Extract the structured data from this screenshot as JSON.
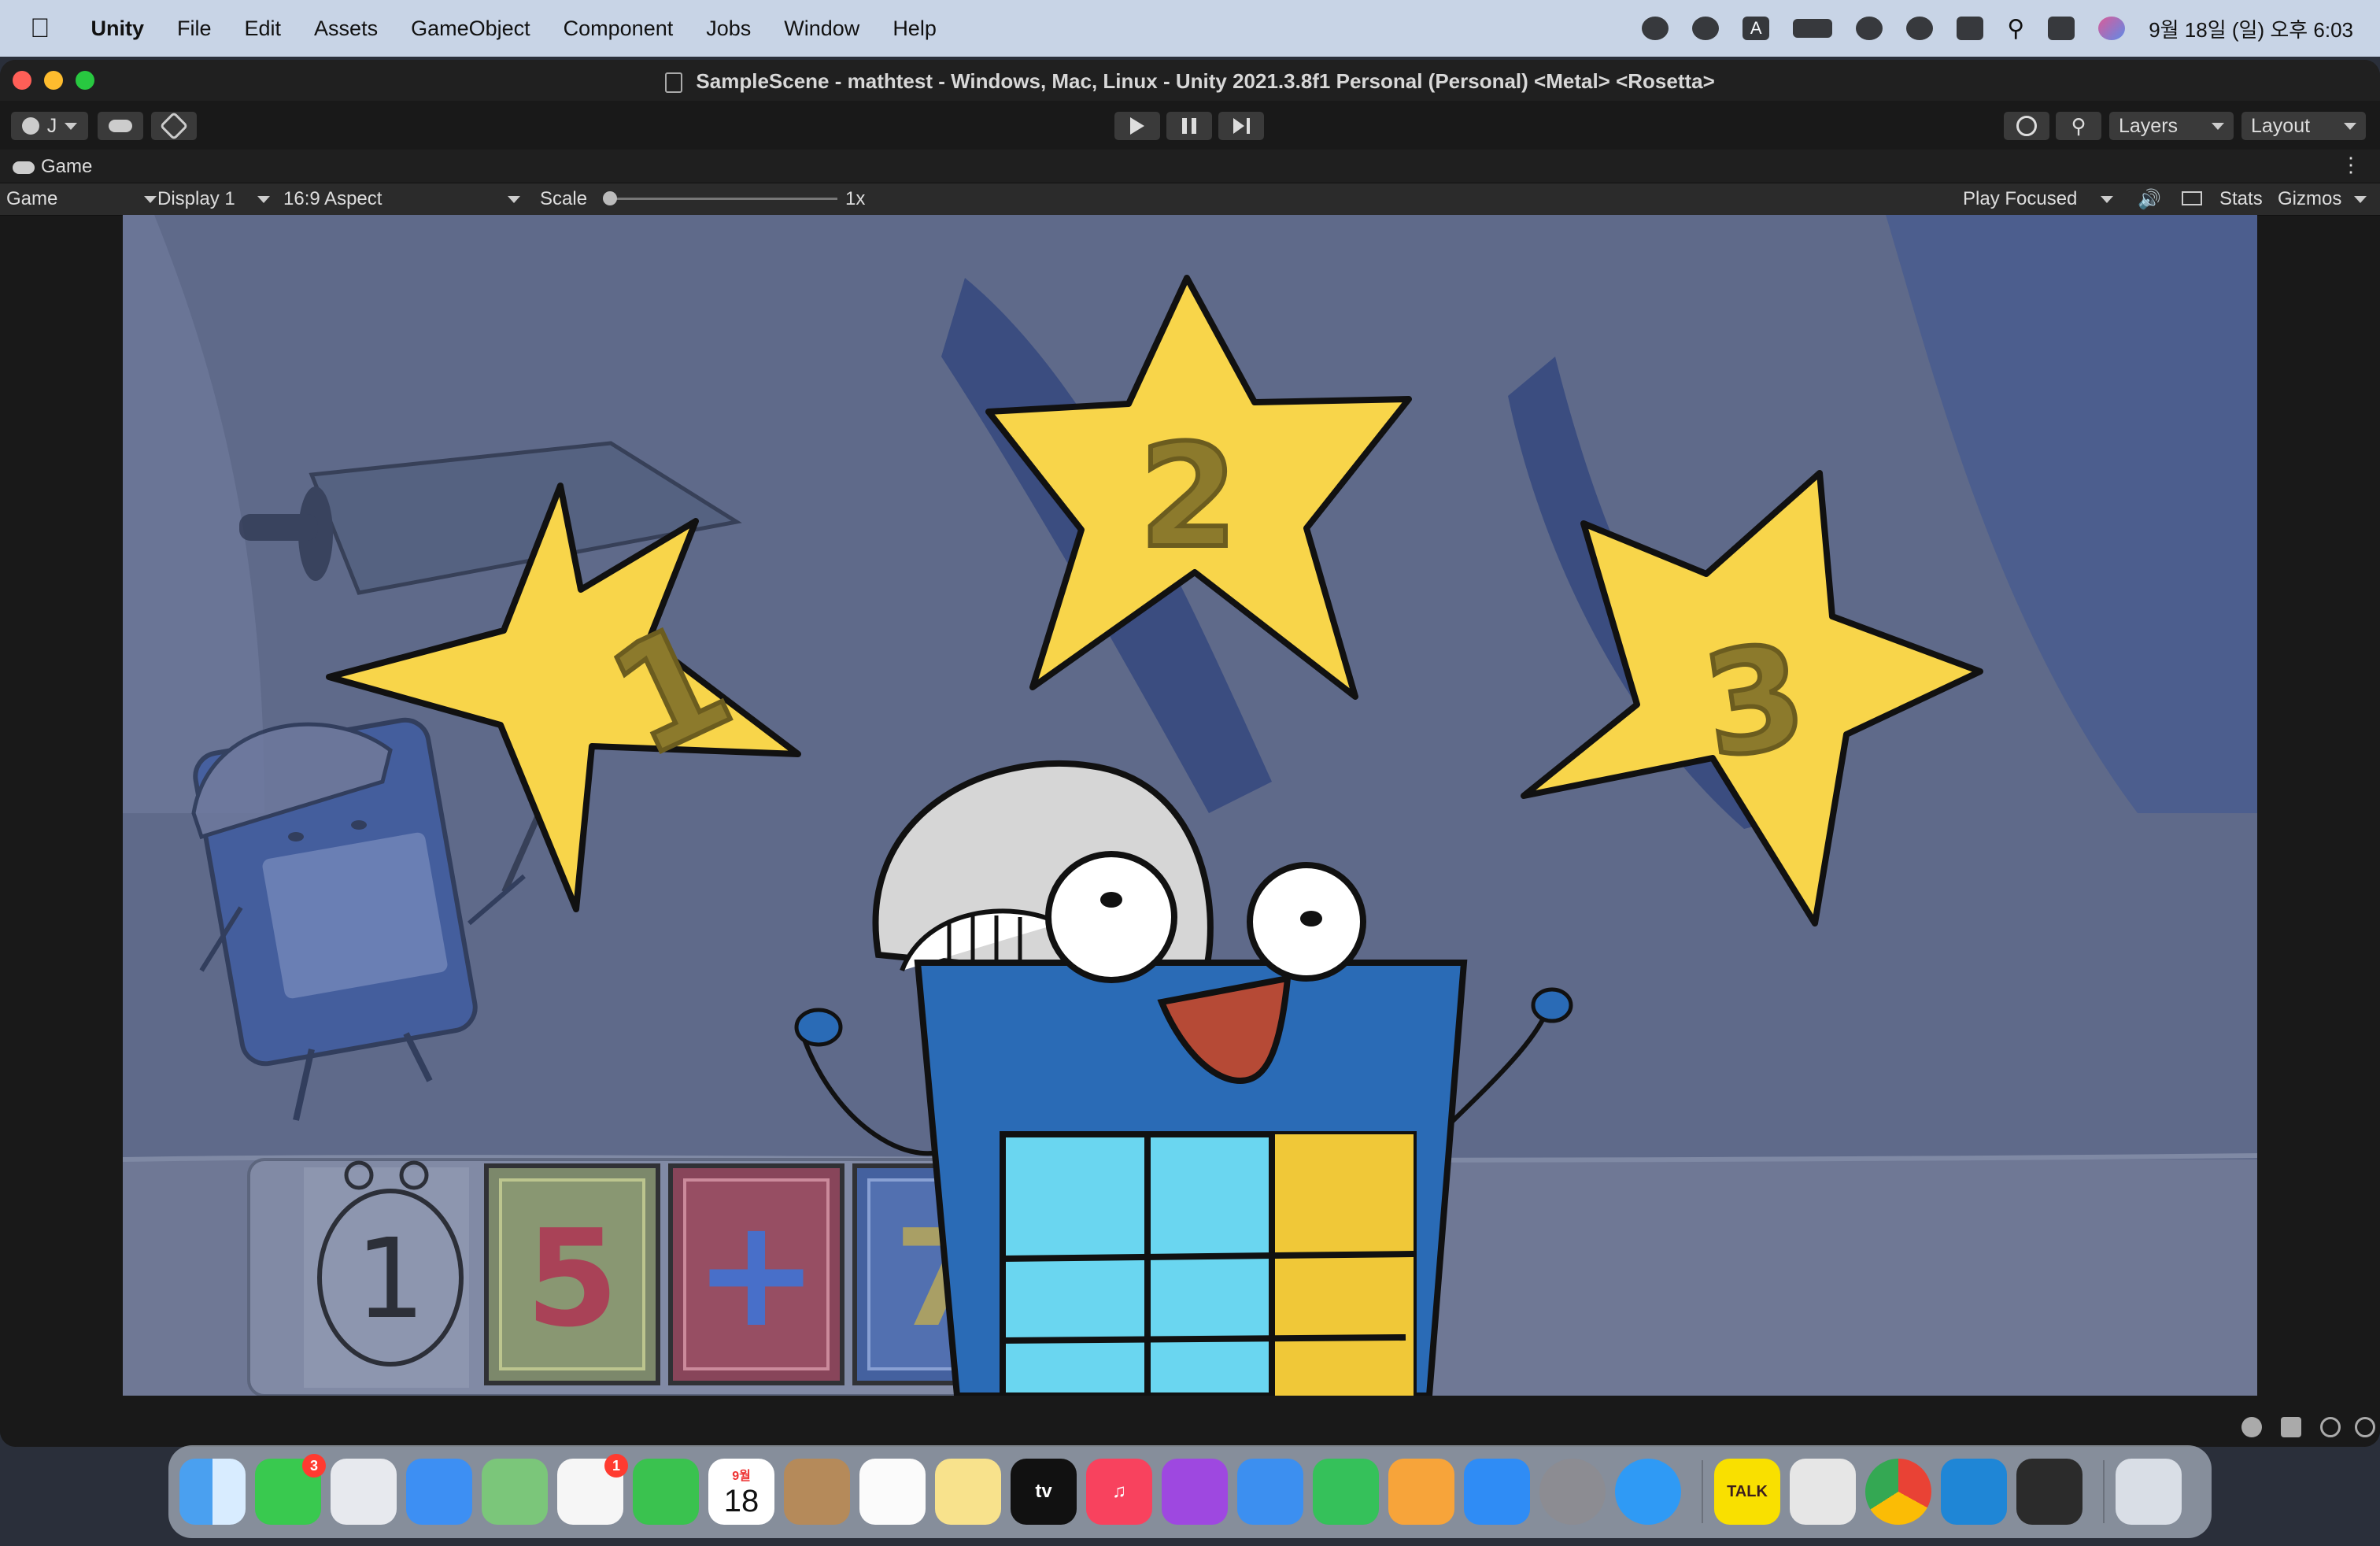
{
  "menubar": {
    "app_name": "Unity",
    "items": [
      "File",
      "Edit",
      "Assets",
      "GameObject",
      "Component",
      "Jobs",
      "Window",
      "Help"
    ],
    "clock": "9월 18일 (일) 오후 6:03"
  },
  "window": {
    "title": "SampleScene - mathtest - Windows, Mac, Linux - Unity 2021.3.8f1 Personal (Personal) <Metal> <Rosetta>"
  },
  "toolbar": {
    "account_label": "J",
    "layers_label": "Layers",
    "layout_label": "Layout"
  },
  "game_tab": {
    "tab_label": "Game",
    "view_select": "Game",
    "display_select": "Display 1",
    "aspect_select": "16:9 Aspect",
    "scale_label": "Scale",
    "scale_value": "1x",
    "play_mode_select": "Play Focused",
    "stats_label": "Stats",
    "gizmos_label": "Gizmos"
  },
  "game": {
    "stars": [
      "1",
      "2",
      "3"
    ],
    "tiles": [
      "5",
      "+",
      "7"
    ],
    "panel_number": "1"
  },
  "dock": {
    "messages_badge": "3",
    "photos_badge": "1",
    "calendar_month": "9월",
    "calendar_day": "18",
    "tv_label": "tv",
    "kakao_label": "TALK"
  }
}
